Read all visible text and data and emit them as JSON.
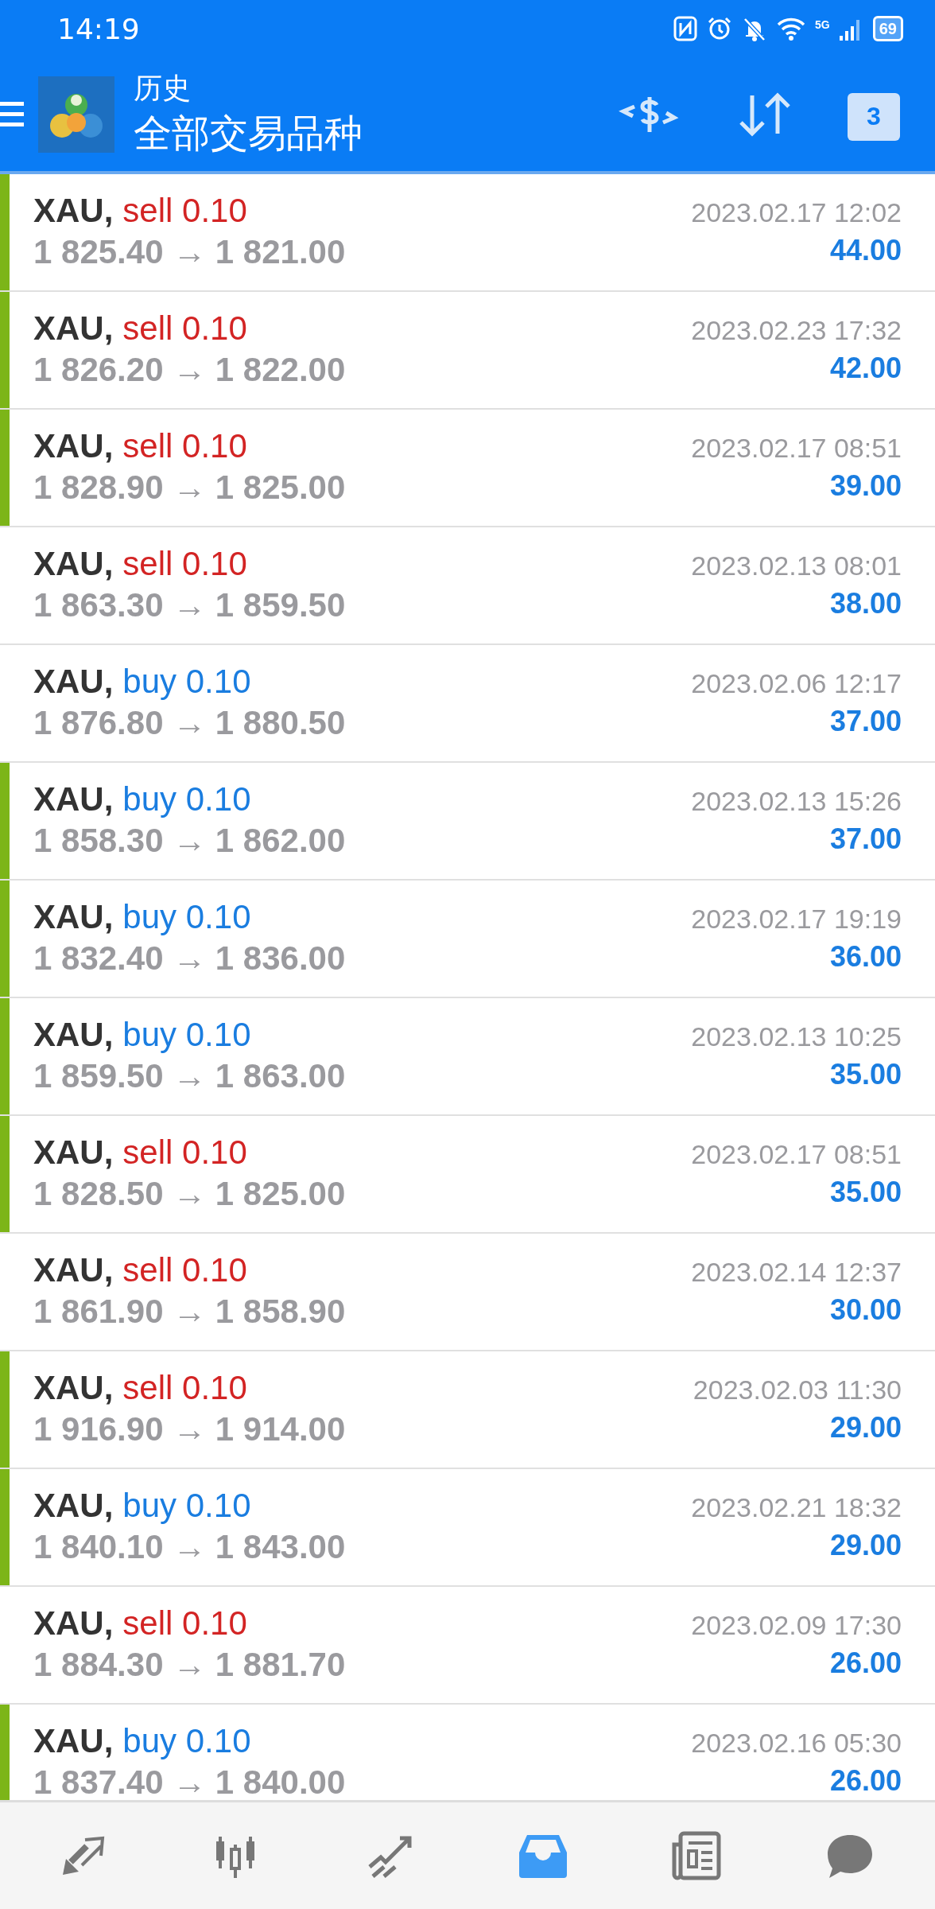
{
  "status_bar": {
    "time": "14:19",
    "network": "5G",
    "battery": "69"
  },
  "toolbar": {
    "title": "历史",
    "subtitle": "全部交易品种",
    "calendar_day": "3"
  },
  "trades": [
    {
      "symbol": "XAU,",
      "kind": "sell",
      "order": "sell 0.10",
      "prices": "1 825.40 → 1 821.00",
      "time": "2023.02.17 12:02",
      "profit": "44.00",
      "highlighted": true
    },
    {
      "symbol": "XAU,",
      "kind": "sell",
      "order": "sell 0.10",
      "prices": "1 826.20 → 1 822.00",
      "time": "2023.02.23 17:32",
      "profit": "42.00",
      "highlighted": true
    },
    {
      "symbol": "XAU,",
      "kind": "sell",
      "order": "sell 0.10",
      "prices": "1 828.90 → 1 825.00",
      "time": "2023.02.17 08:51",
      "profit": "39.00",
      "highlighted": true
    },
    {
      "symbol": "XAU,",
      "kind": "sell",
      "order": "sell 0.10",
      "prices": "1 863.30 → 1 859.50",
      "time": "2023.02.13 08:01",
      "profit": "38.00",
      "highlighted": false
    },
    {
      "symbol": "XAU,",
      "kind": "buy",
      "order": "buy 0.10",
      "prices": "1 876.80 → 1 880.50",
      "time": "2023.02.06 12:17",
      "profit": "37.00",
      "highlighted": false
    },
    {
      "symbol": "XAU,",
      "kind": "buy",
      "order": "buy 0.10",
      "prices": "1 858.30 → 1 862.00",
      "time": "2023.02.13 15:26",
      "profit": "37.00",
      "highlighted": true
    },
    {
      "symbol": "XAU,",
      "kind": "buy",
      "order": "buy 0.10",
      "prices": "1 832.40 → 1 836.00",
      "time": "2023.02.17 19:19",
      "profit": "36.00",
      "highlighted": true
    },
    {
      "symbol": "XAU,",
      "kind": "buy",
      "order": "buy 0.10",
      "prices": "1 859.50 → 1 863.00",
      "time": "2023.02.13 10:25",
      "profit": "35.00",
      "highlighted": true
    },
    {
      "symbol": "XAU,",
      "kind": "sell",
      "order": "sell 0.10",
      "prices": "1 828.50 → 1 825.00",
      "time": "2023.02.17 08:51",
      "profit": "35.00",
      "highlighted": true
    },
    {
      "symbol": "XAU,",
      "kind": "sell",
      "order": "sell 0.10",
      "prices": "1 861.90 → 1 858.90",
      "time": "2023.02.14 12:37",
      "profit": "30.00",
      "highlighted": false
    },
    {
      "symbol": "XAU,",
      "kind": "sell",
      "order": "sell 0.10",
      "prices": "1 916.90 → 1 914.00",
      "time": "2023.02.03 11:30",
      "profit": "29.00",
      "highlighted": true
    },
    {
      "symbol": "XAU,",
      "kind": "buy",
      "order": "buy 0.10",
      "prices": "1 840.10 → 1 843.00",
      "time": "2023.02.21 18:32",
      "profit": "29.00",
      "highlighted": true
    },
    {
      "symbol": "XAU,",
      "kind": "sell",
      "order": "sell 0.10",
      "prices": "1 884.30 → 1 881.70",
      "time": "2023.02.09 17:30",
      "profit": "26.00",
      "highlighted": false
    },
    {
      "symbol": "XAU,",
      "kind": "buy",
      "order": "buy 0.10",
      "prices": "1 837.40 → 1 840.00",
      "time": "2023.02.16 05:30",
      "profit": "26.00",
      "highlighted": true
    }
  ],
  "bottom_nav": [
    {
      "selected": false
    },
    {
      "selected": false
    },
    {
      "selected": false
    },
    {
      "selected": true
    },
    {
      "selected": false
    },
    {
      "selected": false
    }
  ]
}
